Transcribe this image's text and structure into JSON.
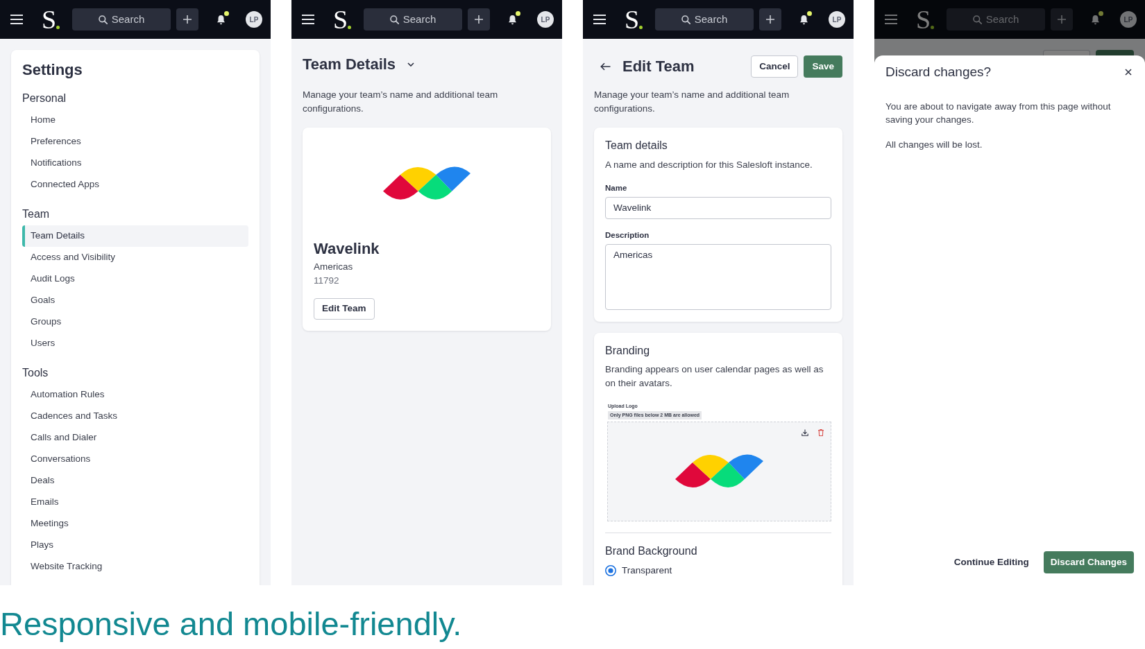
{
  "screens": [
    {
      "kind": "settings_nav",
      "topbar": {
        "logo": "S",
        "search_button": "Search",
        "unread": true,
        "avatar": "LP"
      },
      "title": "Settings",
      "sections": [
        {
          "heading": "Personal",
          "items": [
            {
              "label": "Home",
              "selected": false
            },
            {
              "label": "Preferences",
              "selected": false
            },
            {
              "label": "Notifications",
              "selected": false
            },
            {
              "label": "Connected Apps",
              "selected": false
            }
          ]
        },
        {
          "heading": "Team",
          "items": [
            {
              "label": "Team Details",
              "selected": true
            },
            {
              "label": "Access and Visibility",
              "selected": false
            },
            {
              "label": "Audit Logs",
              "selected": false
            },
            {
              "label": "Goals",
              "selected": false
            },
            {
              "label": "Groups",
              "selected": false
            },
            {
              "label": "Users",
              "selected": false
            }
          ]
        },
        {
          "heading": "Tools",
          "items": [
            {
              "label": "Automation Rules",
              "selected": false
            },
            {
              "label": "Cadences and Tasks",
              "selected": false
            },
            {
              "label": "Calls and Dialer",
              "selected": false
            },
            {
              "label": "Conversations",
              "selected": false
            },
            {
              "label": "Deals",
              "selected": false
            },
            {
              "label": "Emails",
              "selected": false
            },
            {
              "label": "Meetings",
              "selected": false
            },
            {
              "label": "Plays",
              "selected": false
            },
            {
              "label": "Website Tracking",
              "selected": false
            }
          ]
        }
      ]
    },
    {
      "kind": "team_details",
      "topbar": {
        "logo": "S",
        "search_button": "Search",
        "unread": true,
        "avatar": "LP"
      },
      "title": "Team Details",
      "description": "Manage your team’s name and additional team configurations.",
      "team": {
        "name": "Wavelink",
        "region": "Americas",
        "id": "11792"
      },
      "edit_button": "Edit Team"
    },
    {
      "kind": "edit_team",
      "topbar": {
        "logo": "S",
        "search_button": "Search",
        "unread": true,
        "avatar": "LP"
      },
      "title": "Edit Team",
      "cancel_button": "Cancel",
      "save_button": "Save",
      "description": "Manage your team’s name and additional team configurations.",
      "details_card": {
        "title": "Team details",
        "description": "A name and description for this Salesloft instance.",
        "fields": [
          {
            "label": "Name",
            "value": "Wavelink",
            "kind": "text"
          },
          {
            "label": "Description",
            "value": "Americas",
            "kind": "textarea"
          }
        ]
      },
      "branding_card": {
        "title": "Branding",
        "description": "Branding appears on user calendar pages as well as on their avatars.",
        "upload_label": "Upload Logo",
        "upload_hint": "Only PNG files below 2 MB are allowed",
        "background_title": "Brand Background",
        "background_options": [
          {
            "label": "Transparent",
            "selected": true
          }
        ]
      }
    },
    {
      "kind": "discard_dialog",
      "topbar": {
        "logo": "S",
        "search_button": "Search",
        "unread": true,
        "avatar": "LP"
      },
      "dialog": {
        "title": "Discard changes?",
        "paragraphs": [
          "You are about to navigate away from this page without saving your changes.",
          "All changes will be lost."
        ],
        "buttons": [
          {
            "label": "Continue Editing",
            "kind": "secondary"
          },
          {
            "label": "Discard Changes",
            "kind": "primary"
          }
        ]
      }
    }
  ],
  "headline": "Responsive and mobile-friendly."
}
